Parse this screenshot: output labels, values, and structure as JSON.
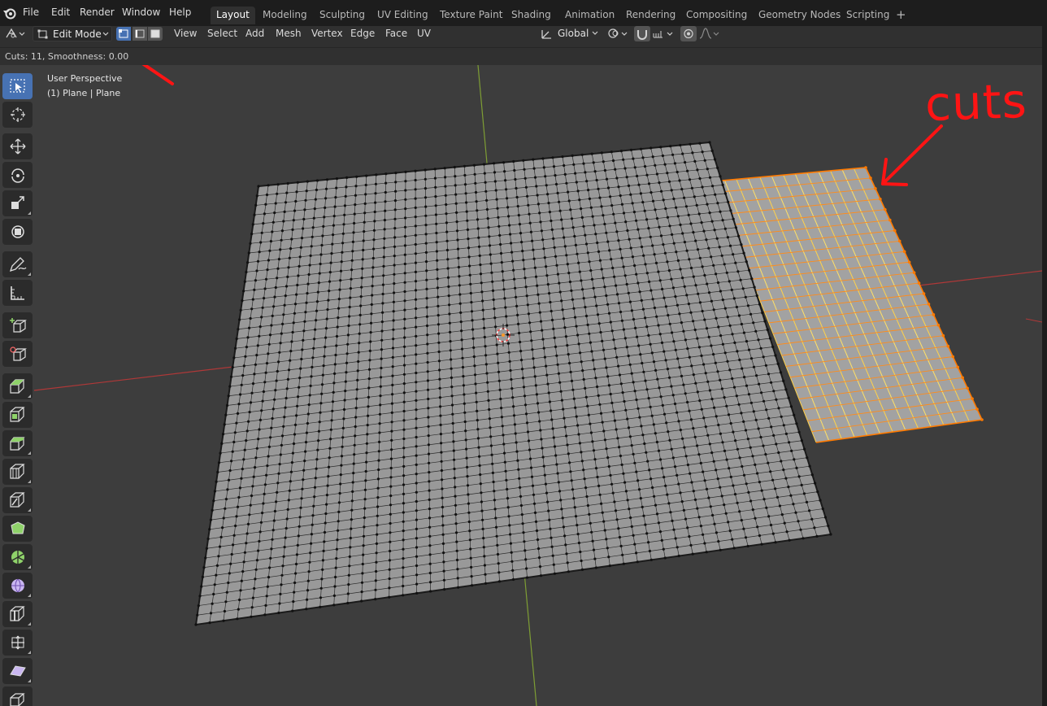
{
  "menu": {
    "items": [
      "File",
      "Edit",
      "Render",
      "Window",
      "Help"
    ]
  },
  "workspaces": {
    "tabs": [
      "Layout",
      "Modeling",
      "Sculpting",
      "UV Editing",
      "Texture Paint",
      "Shading",
      "Animation",
      "Rendering",
      "Compositing",
      "Geometry Nodes",
      "Scripting"
    ],
    "active": "Layout",
    "add_label": "+"
  },
  "header": {
    "mode": "Edit Mode",
    "menus": [
      "View",
      "Select",
      "Add",
      "Mesh",
      "Vertex",
      "Edge",
      "Face",
      "UV"
    ],
    "orientation": "Global"
  },
  "operator": {
    "text": "Cuts: 11, Smoothness: 0.00"
  },
  "viewport": {
    "perspective": "User Perspective",
    "object": "(1) Plane | Plane"
  },
  "annotation": {
    "label": "cuts",
    "color": "#ff1414"
  },
  "colors": {
    "accent": "#4772b3",
    "selected_edge": "#ff8c1a",
    "selected_edge_light": "#ffe066",
    "mesh_face": "#9a9a9a",
    "x_axis": "#c23a3a",
    "y_axis": "#8db03a"
  },
  "toolbar": {
    "tools": [
      "select-box",
      "cursor",
      "move",
      "rotate",
      "scale",
      "transform",
      "annotate",
      "measure",
      "add-cube",
      "duplicate-cube",
      "extrude",
      "inset",
      "bevel",
      "loop-cut",
      "knife",
      "poly-build",
      "spin",
      "smooth",
      "shrink",
      "push-pull",
      "shear",
      "rip"
    ]
  }
}
